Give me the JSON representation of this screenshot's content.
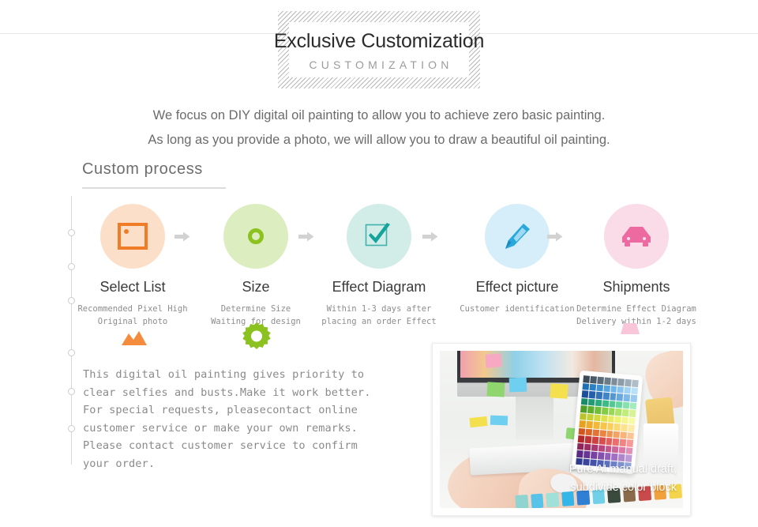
{
  "header": {
    "title_main": "Exclusive Customization",
    "title_sub": "CUSTOMIZATION"
  },
  "intro": {
    "line1": "We focus on DIY digital oil painting to allow you to achieve zero basic painting.",
    "line2": "As long as you provide a photo, we will allow you to draw a beautiful oil painting."
  },
  "section": {
    "heading": "Custom process"
  },
  "process": {
    "arrow_glyph": "➡",
    "steps": [
      {
        "title": "Select List",
        "desc_line1": "Recommended Pixel High",
        "desc_line2": "Original photo",
        "icon": "image-frame-icon",
        "circle_color": "#fcdfc8",
        "icon_color": "#f07c28"
      },
      {
        "title": "Size",
        "desc_line1": "Determine Size",
        "desc_line2": "Waiting for design",
        "icon": "ring-circle-icon",
        "circle_color": "#dceec0",
        "icon_color": "#8cc220"
      },
      {
        "title": "Effect Diagram",
        "desc_line1": "Within 1-3 days after",
        "desc_line2": "placing an order Effect",
        "icon": "checkbox-check-icon",
        "circle_color": "#d2ece8",
        "icon_color": "#1fa8a0"
      },
      {
        "title": "Effect picture",
        "desc_line1": "Customer identification",
        "desc_line2": "",
        "icon": "pen-icon",
        "circle_color": "#d6eefa",
        "icon_color": "#29a8dd"
      },
      {
        "title": "Shipments",
        "desc_line1": "Determine Effect Diagram",
        "desc_line2": "Delivery within 1-2 days",
        "icon": "delivery-car-icon",
        "circle_color": "#fadbe8",
        "icon_color": "#ec6aa0"
      }
    ]
  },
  "body_copy": {
    "line1": "This digital oil painting gives priority to",
    "line2": "clear selfies and busts.Make it work better.",
    "line3": "For special requests, pleasecontact online",
    "line4": "customer service or make your own remarks.",
    "line5": "Please contact customer service to confirm",
    "line6": "your order."
  },
  "photo": {
    "caption_line1": "Pure AI manual draft,",
    "caption_line2": "subdivide color block",
    "alt": "hands typing on keyboard beside tablet showing color palette"
  },
  "colors": {
    "rule": "#e8e8e8",
    "timeline": "#d9d9d9",
    "text_body": "#8a8a8a",
    "text_title": "#2b2b2b",
    "accent_orange": "#f07c28",
    "accent_green": "#8cc220",
    "accent_teal": "#1fa8a0",
    "accent_blue": "#29a8dd",
    "accent_pink": "#ec6aa0"
  }
}
